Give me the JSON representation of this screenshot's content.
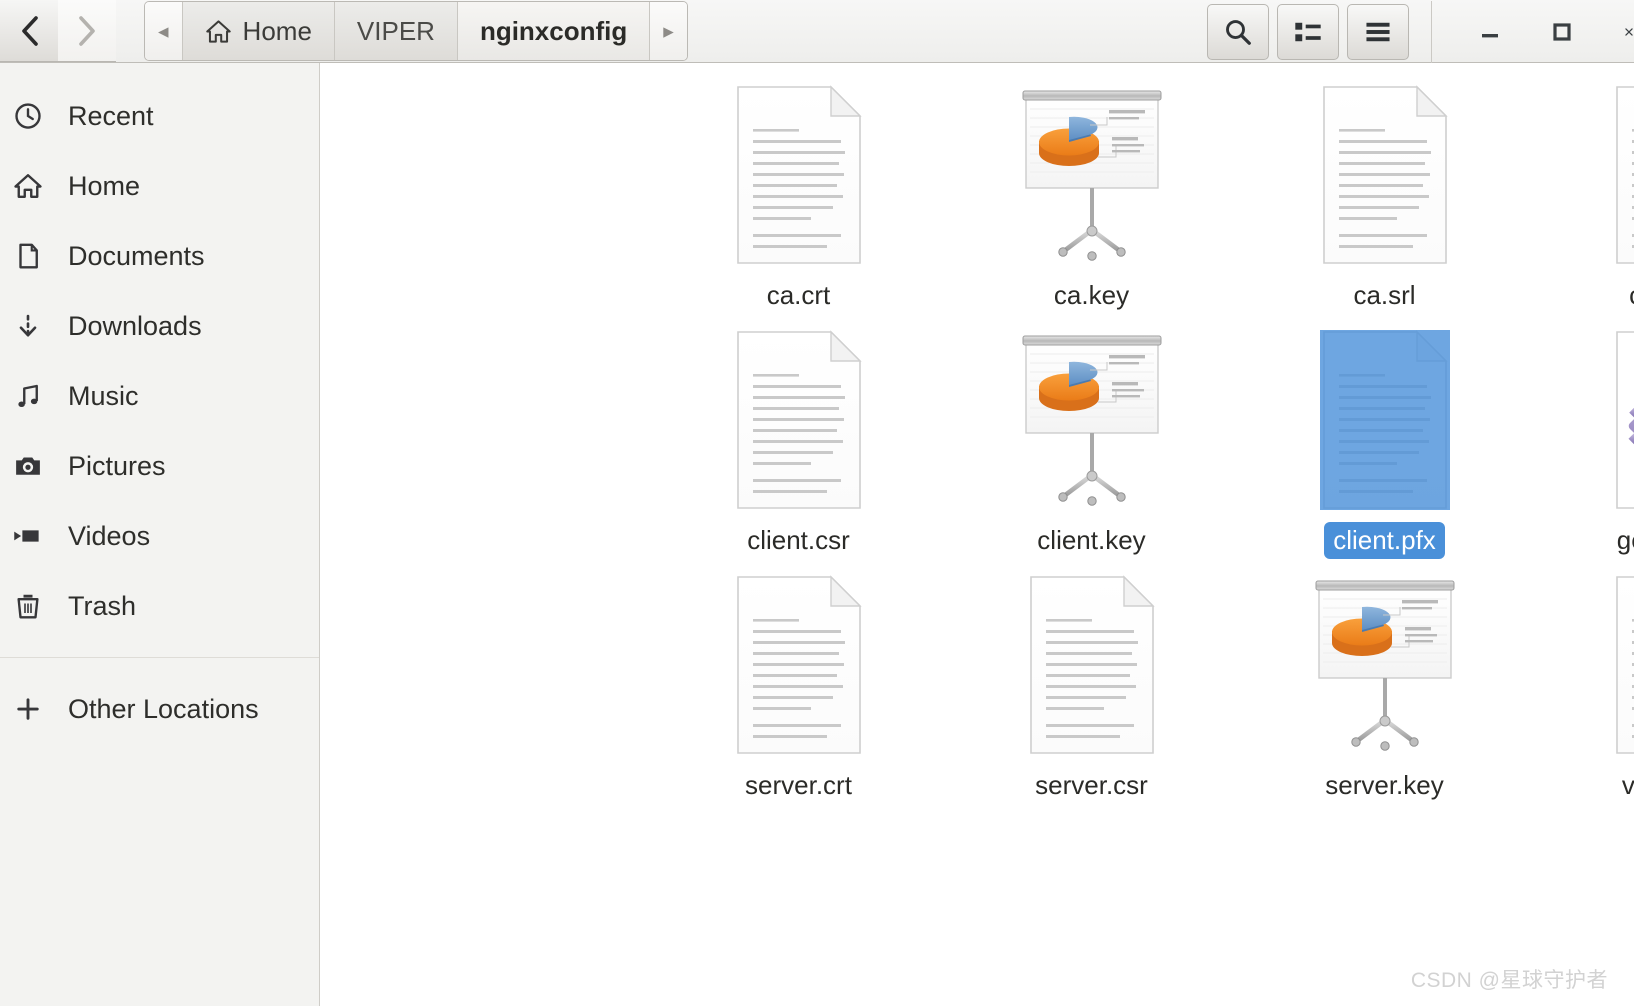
{
  "window": {
    "minimize_label": "–",
    "maximize_label": "□",
    "close_label": "×"
  },
  "toolbar": {
    "back_label": "‹",
    "forward_label": "›",
    "crumb_prev_label": "◂",
    "crumb_next_label": "▸",
    "search_icon": "search-icon",
    "view_list_icon": "view-list-icon",
    "menu_icon": "hamburger-menu-icon"
  },
  "breadcrumb": {
    "items": [
      {
        "label": "Home",
        "icon": "home-icon",
        "current": false
      },
      {
        "label": "VIPER",
        "icon": "",
        "current": false
      },
      {
        "label": "nginxconfig",
        "icon": "",
        "current": true
      }
    ]
  },
  "sidebar": {
    "items": [
      {
        "label": "Recent",
        "icon": "clock-icon"
      },
      {
        "label": "Home",
        "icon": "home-icon"
      },
      {
        "label": "Documents",
        "icon": "document-icon"
      },
      {
        "label": "Downloads",
        "icon": "download-icon"
      },
      {
        "label": "Music",
        "icon": "music-note-icon"
      },
      {
        "label": "Pictures",
        "icon": "camera-icon"
      },
      {
        "label": "Videos",
        "icon": "video-icon"
      },
      {
        "label": "Trash",
        "icon": "trash-icon"
      }
    ],
    "other_locations": {
      "label": "Other Locations",
      "icon": "plus-icon"
    }
  },
  "files": [
    {
      "name": "ca.crt",
      "type": "text-document",
      "selected": false
    },
    {
      "name": "ca.key",
      "type": "presentation",
      "selected": false
    },
    {
      "name": "ca.srl",
      "type": "text-document",
      "selected": false
    },
    {
      "name": "client.crt",
      "type": "text-document",
      "selected": false
    },
    {
      "name": "client.csr",
      "type": "text-document",
      "selected": false
    },
    {
      "name": "client.key",
      "type": "presentation",
      "selected": false
    },
    {
      "name": "client.pfx",
      "type": "text-document",
      "selected": true
    },
    {
      "name": "gencert.sh",
      "type": "script",
      "selected": false
    },
    {
      "name": "server.crt",
      "type": "text-document",
      "selected": false
    },
    {
      "name": "server.csr",
      "type": "text-document",
      "selected": false
    },
    {
      "name": "server.key",
      "type": "presentation",
      "selected": false
    },
    {
      "name": "viper.conf",
      "type": "text-document",
      "selected": false
    }
  ],
  "watermark": {
    "text": "CSDN @星球守护者"
  },
  "colors": {
    "selection": "#4a90d9",
    "sidebar_bg": "#f3f3f1",
    "header_bg": "#eeeeec",
    "content_bg": "#ffffff",
    "accent_orange": "#f08a24",
    "accent_blue": "#6d9fd0",
    "script_purple": "#9b8ec4"
  }
}
